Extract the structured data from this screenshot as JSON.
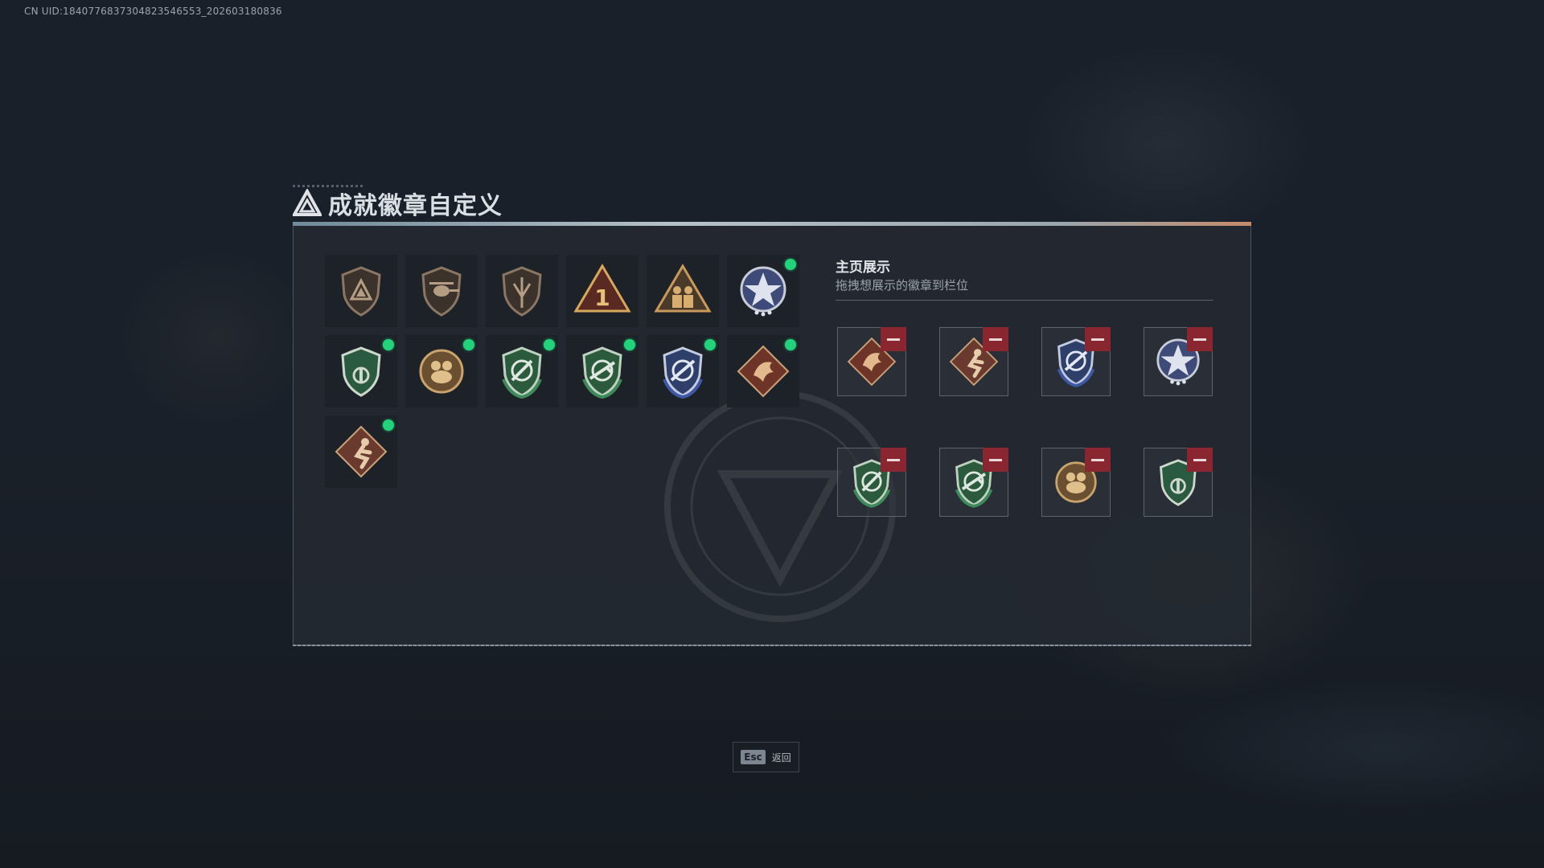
{
  "uid_text": "CN UID:1840776837304823546553_202603180836",
  "title": "成就徽章自定义",
  "display": {
    "title": "主页展示",
    "subtitle": "拖拽想展示的徽章到栏位"
  },
  "footer": {
    "esc_key": "Esc",
    "esc_label": "返回"
  },
  "colors": {
    "accent_green": "#21d47b",
    "remove_red": "#8a2630",
    "panel_bg": "#24292f"
  },
  "inventory": [
    {
      "icon": "bronze-triangle-shield-badge-icon",
      "new": false
    },
    {
      "icon": "bronze-helicopter-shield-badge-icon",
      "new": false
    },
    {
      "icon": "bronze-winged-shield-badge-icon",
      "new": false
    },
    {
      "icon": "gold-number-one-triangle-badge-icon",
      "new": false
    },
    {
      "icon": "gold-soldiers-triangle-badge-icon",
      "new": false
    },
    {
      "icon": "blue-star-medal-badge-icon",
      "new": true
    },
    {
      "icon": "green-beret-shield-badge-icon",
      "new": true
    },
    {
      "icon": "gold-frog-emblem-badge-icon",
      "new": true
    },
    {
      "icon": "green-crosshair-shield-badge-icon",
      "new": true
    },
    {
      "icon": "green-rifle-shield-badge-icon",
      "new": true
    },
    {
      "icon": "blue-crosshair-shield-badge-icon",
      "new": true
    },
    {
      "icon": "red-dragon-diamond-badge-icon",
      "new": true
    },
    {
      "icon": "red-runner-diamond-badge-icon",
      "new": true
    }
  ],
  "display_slots": [
    {
      "icon": "red-dragon-diamond-badge-icon"
    },
    {
      "icon": "red-runner-diamond-badge-icon"
    },
    {
      "icon": "blue-crosshair-shield-badge-icon"
    },
    {
      "icon": "blue-star-medal-badge-icon"
    },
    {
      "icon": "green-crosshair-shield-badge-icon"
    },
    {
      "icon": "green-rifle-shield-badge-icon"
    },
    {
      "icon": "gold-frog-emblem-badge-icon"
    },
    {
      "icon": "green-beret-shield-badge-icon"
    }
  ]
}
